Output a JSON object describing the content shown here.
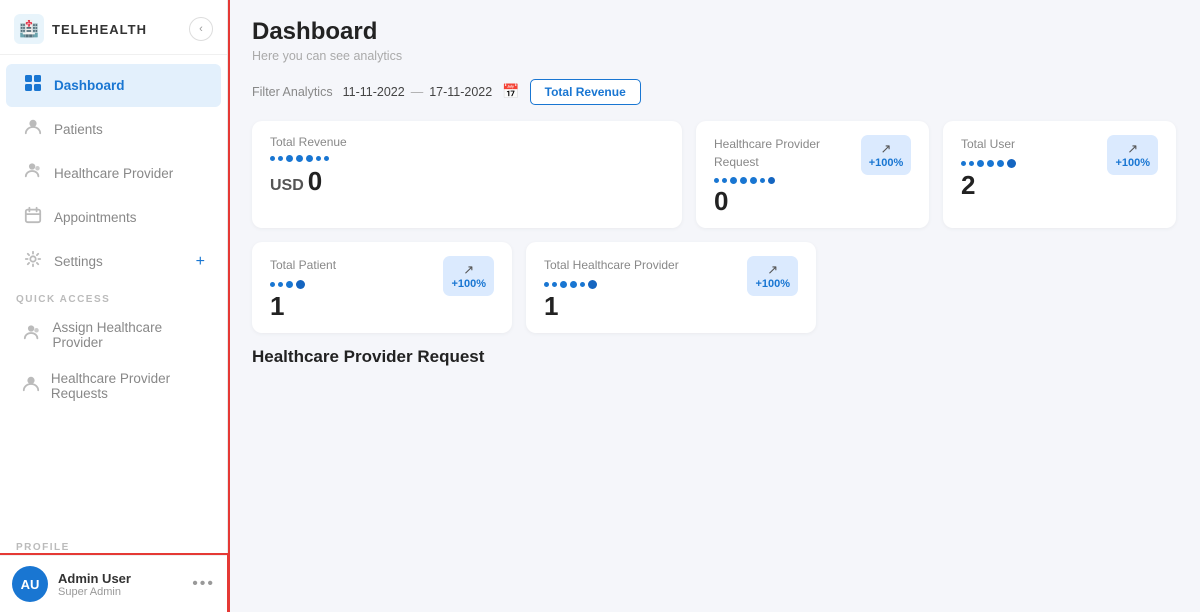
{
  "brand": {
    "name": "TELEHEALTH",
    "icon": "🏥"
  },
  "sidebar": {
    "nav_items": [
      {
        "id": "dashboard",
        "label": "Dashboard",
        "icon": "⊞",
        "active": true
      },
      {
        "id": "patients",
        "label": "Patients",
        "icon": "👤",
        "active": false
      },
      {
        "id": "healthcare-provider",
        "label": "Healthcare Provider",
        "icon": "👨‍⚕️",
        "active": false
      },
      {
        "id": "appointments",
        "label": "Appointments",
        "icon": "📅",
        "active": false
      },
      {
        "id": "settings",
        "label": "Settings",
        "icon": "⚙️",
        "active": false,
        "has_plus": true
      }
    ],
    "quick_access_label": "QUICK ACCESS",
    "quick_access_items": [
      {
        "id": "assign-provider",
        "label": "Assign Healthcare Provider",
        "icon": "👨‍⚕️"
      },
      {
        "id": "provider-requests",
        "label": "Healthcare Provider Requests",
        "icon": "👤"
      }
    ],
    "profile_section_label": "PROFILE",
    "profile": {
      "initials": "AU",
      "name": "Admin User",
      "role": "Super Admin",
      "dots": "..."
    }
  },
  "main": {
    "title": "Dashboard",
    "subtitle": "Here you can see analytics",
    "filter": {
      "label": "Filter Analytics",
      "date_start": "11-11-2022",
      "date_end": "17-11-2022",
      "btn_label": "Total Revenue"
    },
    "stats": [
      {
        "id": "total-revenue",
        "label": "Total Revenue",
        "value": "0",
        "prefix": "USD",
        "wide": true,
        "show_chart": false
      },
      {
        "id": "provider-request",
        "label": "Healthcare Provider Request",
        "value": "0",
        "pct": "+100%",
        "show_chart": true
      },
      {
        "id": "total-user",
        "label": "Total User",
        "value": "2",
        "pct": "+100%",
        "show_chart": true
      },
      {
        "id": "total-patient",
        "label": "Total Patient",
        "value": "1",
        "pct": "+100%",
        "show_chart": true
      },
      {
        "id": "total-healthcare",
        "label": "Total Healthcare Provider",
        "value": "1",
        "pct": "+100%",
        "show_chart": true
      }
    ],
    "bottom_section_title": "Healthcare Provider Request"
  }
}
